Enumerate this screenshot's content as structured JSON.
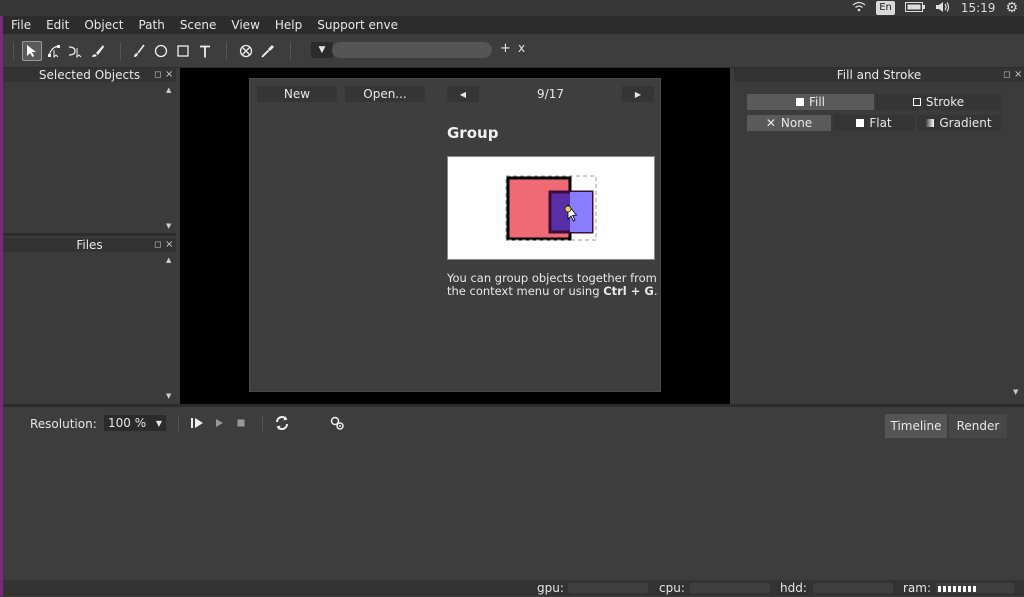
{
  "system": {
    "lang": "En",
    "time": "15:19"
  },
  "menubar": {
    "items": [
      "File",
      "Edit",
      "Object",
      "Path",
      "Scene",
      "View",
      "Help",
      "Support enve"
    ]
  },
  "toolbar": {
    "layer_add": "+",
    "layer_close": "x"
  },
  "left_panels": {
    "selected_title": "Selected Objects",
    "files_title": "Files"
  },
  "welcome": {
    "new_label": "New",
    "open_label": "Open...",
    "page": "9/17",
    "tip_title": "Group",
    "tip_text_prefix": "You can group objects together from the context menu or using ",
    "tip_shortcut": "Ctrl + G",
    "tip_text_suffix": "."
  },
  "fill_stroke": {
    "title": "Fill and Stroke",
    "fill_label": "Fill",
    "stroke_label": "Stroke",
    "none_label": "None",
    "flat_label": "Flat",
    "gradient_label": "Gradient"
  },
  "bottom": {
    "resolution_label": "Resolution:",
    "resolution_value": "100 %",
    "timeline_label": "Timeline",
    "render_label": "Render"
  },
  "status": {
    "gpu_label": "gpu:",
    "cpu_label": "cpu:",
    "hdd_label": "hdd:",
    "ram_label": "ram:"
  },
  "colors": {
    "group_red": "#f06a76",
    "group_purple": "#5a2ea6",
    "group_violet": "#8a7cff",
    "accent_purple": "#7a2a7a"
  }
}
